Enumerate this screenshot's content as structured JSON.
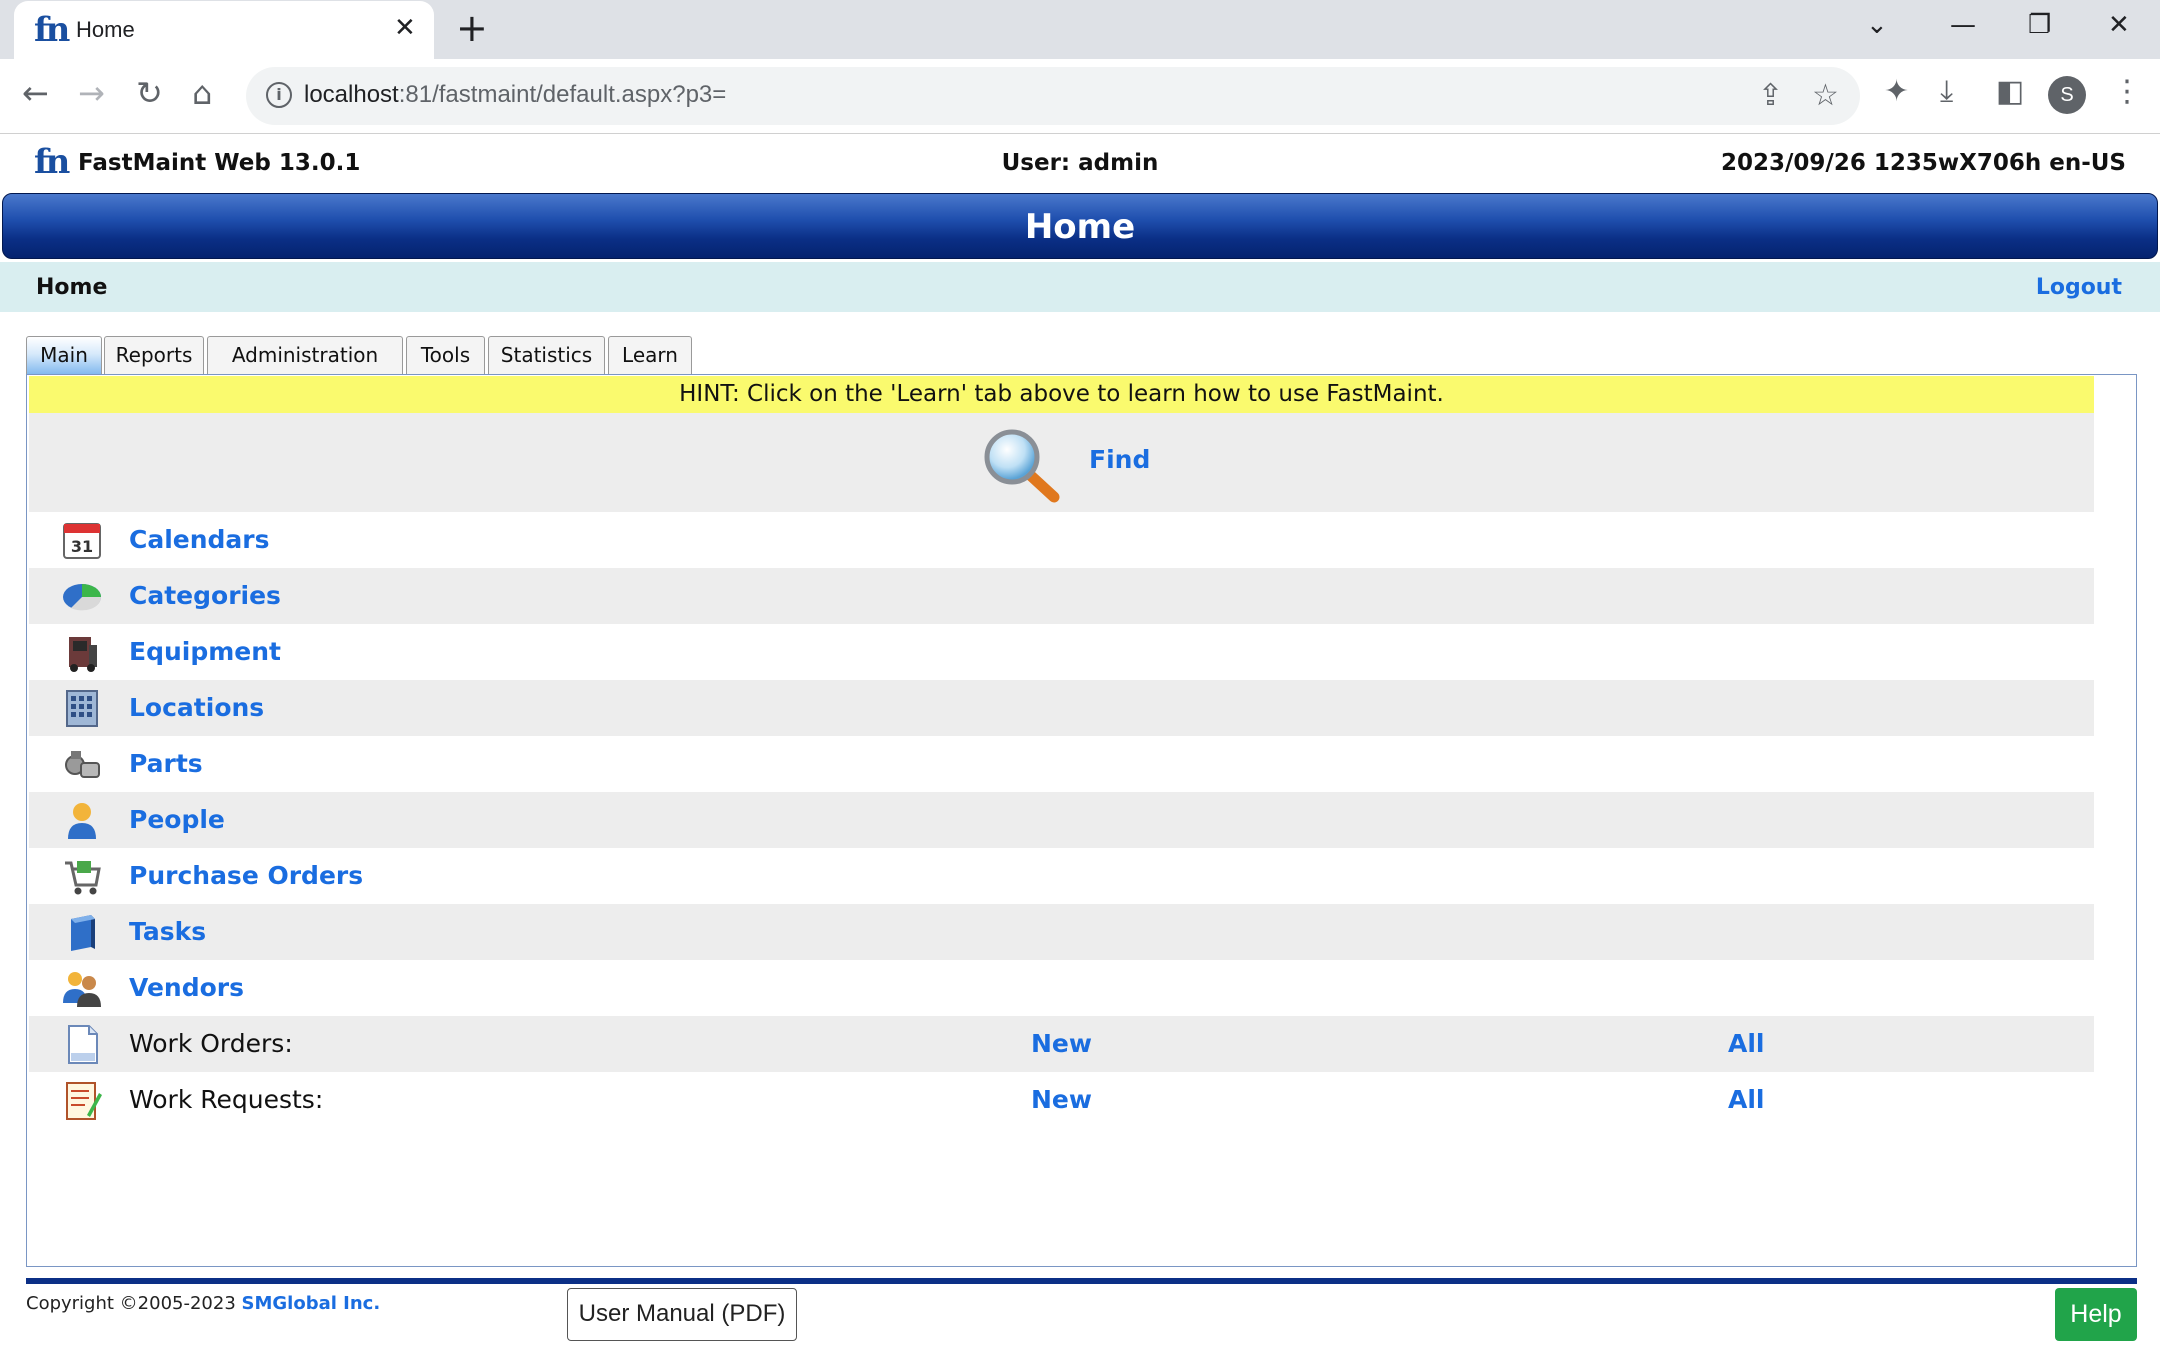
{
  "browser": {
    "tab_title": "Home",
    "url_host": "localhost",
    "url_path": ":81/fastmaint/default.aspx?p3=",
    "profile_initial": "S"
  },
  "app": {
    "logo_text": "fn",
    "name": "FastMaint Web 13.0.1",
    "user": "User: admin",
    "stamp": "2023/09/26 1235wX706h en-US",
    "banner_title": "Home",
    "breadcrumb": "Home",
    "logout": "Logout"
  },
  "tabs": [
    "Main",
    "Reports",
    "Administration",
    "Tools",
    "Statistics",
    "Learn"
  ],
  "hint": "HINT: Click on the 'Learn' tab above to learn how to use FastMaint.",
  "find_label": "Find",
  "menu": [
    {
      "label": "Calendars",
      "icon": "calendar-icon"
    },
    {
      "label": "Categories",
      "icon": "categories-icon"
    },
    {
      "label": "Equipment",
      "icon": "equipment-icon"
    },
    {
      "label": "Locations",
      "icon": "building-icon"
    },
    {
      "label": "Parts",
      "icon": "parts-icon"
    },
    {
      "label": "People",
      "icon": "person-icon"
    },
    {
      "label": "Purchase Orders",
      "icon": "cart-icon"
    },
    {
      "label": "Tasks",
      "icon": "tasks-icon"
    },
    {
      "label": "Vendors",
      "icon": "vendors-icon"
    }
  ],
  "work": [
    {
      "label": "Work Orders:",
      "new": "New",
      "all": "All",
      "icon": "document-icon"
    },
    {
      "label": "Work Requests:",
      "new": "New",
      "all": "All",
      "icon": "notepad-icon"
    }
  ],
  "footer": {
    "copyright": "Copyright ©2005-2023 ",
    "company": "SMGlobal Inc.",
    "manual": "User Manual (PDF)",
    "help": "Help"
  },
  "colors": {
    "link": "#1a6de0",
    "banner": "#0b2f86",
    "hint": "#fafa6e",
    "help": "#21a44a"
  }
}
